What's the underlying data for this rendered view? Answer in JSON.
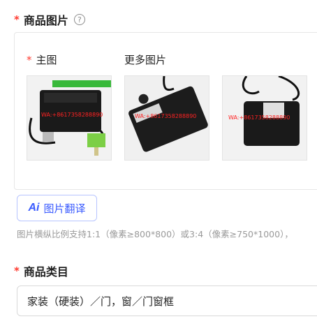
{
  "product_images": {
    "label": "商品图片",
    "required_mark": "*",
    "help_icon": "question-circle-icon",
    "main_label": "主图",
    "more_label": "更多图片",
    "images": [
      {
        "watermark": "WA:+8617358288890"
      },
      {
        "watermark": "WA:+8617358288890"
      },
      {
        "watermark": "WA:+8617358288890"
      }
    ],
    "ai_button": {
      "icon_text": "Ai",
      "label": "图片翻译"
    },
    "hint": "图片横纵比例支持1:1（像素≥800*800）或3:4（像素≥750*1000），"
  },
  "category": {
    "label": "商品类目",
    "required_mark": "*",
    "value": "家装（硬装）／门，窗／门窗框"
  },
  "colors": {
    "required": "#ff3b30",
    "accent": "#3a5bff"
  }
}
